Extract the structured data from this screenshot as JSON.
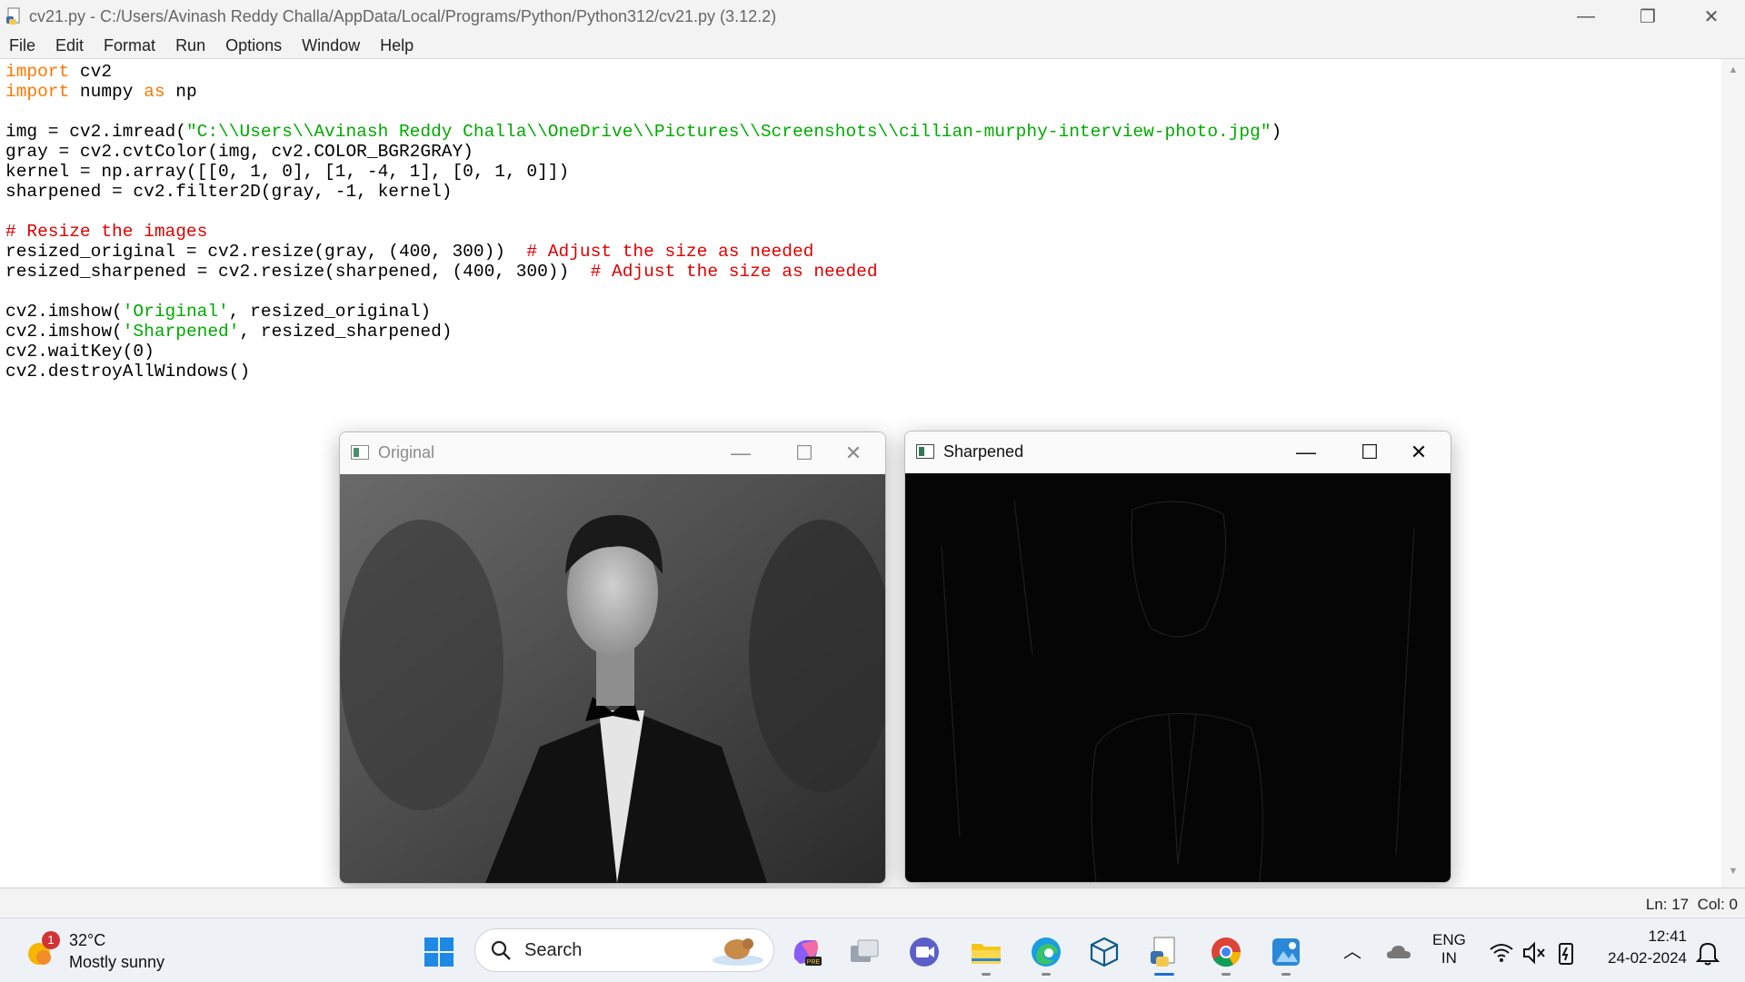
{
  "window": {
    "title": "cv21.py - C:/Users/Avinash Reddy Challa/AppData/Local/Programs/Python/Python312/cv21.py (3.12.2)",
    "controls": {
      "minimize": "—",
      "restore": "❐",
      "close": "✕"
    }
  },
  "menu": [
    "File",
    "Edit",
    "Format",
    "Run",
    "Options",
    "Window",
    "Help"
  ],
  "code": {
    "lines": [
      "import cv2",
      "import numpy as np",
      "",
      "img = cv2.imread(\"C:\\\\Users\\\\Avinash Reddy Challa\\\\OneDrive\\\\Pictures\\\\Screenshots\\\\cillian-murphy-interview-photo.jpg\")",
      "gray = cv2.cvtColor(img, cv2.COLOR_BGR2GRAY)",
      "kernel = np.array([[0, 1, 0], [1, -4, 1], [0, 1, 0]])",
      "sharpened = cv2.filter2D(gray, -1, kernel)",
      "",
      "# Resize the images",
      "resized_original = cv2.resize(gray, (400, 300))  # Adjust the size as needed",
      "resized_sharpened = cv2.resize(sharpened, (400, 300))  # Adjust the size as needed",
      "",
      "cv2.imshow('Original', resized_original)",
      "cv2.imshow('Sharpened', resized_sharpened)",
      "cv2.waitKey(0)",
      "cv2.destroyAllWindows()"
    ]
  },
  "status": {
    "ln": "Ln: 17",
    "col": "Col: 0"
  },
  "image_windows": {
    "original": {
      "title": "Original"
    },
    "sharpened": {
      "title": "Sharpened"
    }
  },
  "taskbar": {
    "weather": {
      "temp": "32°C",
      "desc": "Mostly sunny",
      "badge": "1"
    },
    "search": {
      "placeholder": "Search"
    },
    "apps": [
      "start-icon",
      "search-icon",
      "copilot-icon",
      "task-view-icon",
      "teams-icon",
      "file-explorer-icon",
      "edge-icon",
      "box-app-icon",
      "python-idle-icon",
      "chrome-icon",
      "photos-icon"
    ],
    "tray": {
      "lang1": "ENG",
      "lang2": "IN",
      "time": "12:41",
      "date": "24-02-2024"
    }
  },
  "colors": {
    "keyword": "#ff7700",
    "string": "#00aa00",
    "comment": "#dd0000"
  }
}
